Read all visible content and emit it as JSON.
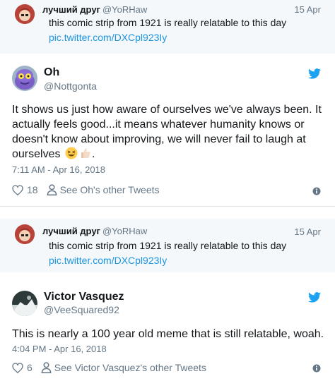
{
  "reply1": {
    "name": "лучший друг",
    "handle": "@YoRHaw",
    "date": "15 Apr",
    "text": "this comic strip from 1921 is really relatable to this day",
    "link": "pic.twitter.com/DXCpl923Iy"
  },
  "tweet1": {
    "name": "Oh",
    "handle": "@Nottgonta",
    "text": "It shows us just how aware of ourselves we've always been. It actually feels good...it means whatever humanity knows or doesn't know about improving, we will never fail to laugh at ourselves",
    "text_end": ".",
    "timestamp": "7:11 AM - Apr 16, 2018",
    "likes": "18",
    "profile_link": "See Oh's other Tweets"
  },
  "reply2": {
    "name": "лучший друг",
    "handle": "@YoRHaw",
    "date": "15 Apr",
    "text": "this comic strip from 1921 is really relatable to this day",
    "link": "pic.twitter.com/DXCpl923Iy"
  },
  "tweet2": {
    "name": "Victor Vasquez",
    "handle": "@VeeSquared92",
    "text": "This is nearly a 100 year old meme that is still relatable, woah.",
    "timestamp": "4:04 PM - Apr 16, 2018",
    "likes": "6",
    "profile_link": "See Victor Vasquez's other Tweets"
  },
  "icons": {
    "brand": "twitter-bird-icon",
    "like": "heart-icon",
    "profile": "person-icon",
    "info": "info-icon",
    "emoji1": "grinning-squinting-face-emoji",
    "emoji2": "thumbs-up-emoji"
  },
  "colors": {
    "brand_blue": "#1da1f2",
    "link_blue": "#1b95e0",
    "muted_text": "#657786",
    "reply_background": "#f5f8fa",
    "divider": "#e1e8ed"
  }
}
